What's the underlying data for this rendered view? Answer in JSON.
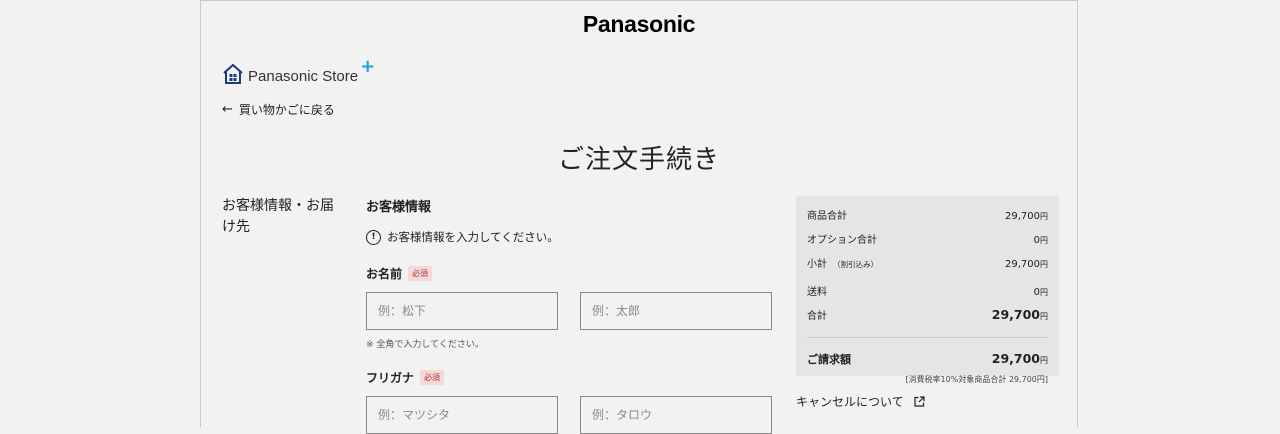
{
  "header": {
    "brand": "Panasonic"
  },
  "store": {
    "name": "Panasonic Store",
    "plus": "+",
    "brand_color": "#1ba1e6"
  },
  "back_link": {
    "arrow": "←",
    "label": "買い物かごに戻る"
  },
  "page_title": "ご注文手続き",
  "section_label": "お客様情報・お届け先",
  "customer_info": {
    "heading": "お客様情報",
    "notice_icon": "!",
    "notice": "お客様情報を入力してください。",
    "name": {
      "label": "お名前",
      "required": "必須",
      "last_placeholder": "例：松下",
      "first_placeholder": "例：太郎",
      "hint": "※ 全角で入力してください。"
    },
    "kana": {
      "label": "フリガナ",
      "required": "必須",
      "last_placeholder": "例：マツシタ",
      "first_placeholder": "例：タロウ"
    }
  },
  "summary": {
    "product_total_label": "商品合計",
    "product_total_value": "29,700",
    "option_total_label": "オプション合計",
    "option_total_value": "0",
    "subtotal_label": "小計",
    "subtotal_note": "（割引込み）",
    "subtotal_value": "29,700",
    "shipping_label": "送料",
    "shipping_value": "0",
    "total_label": "合計",
    "total_value": "29,700",
    "billing_label": "ご請求額",
    "billing_value": "29,700",
    "currency": "円",
    "tax_note": "[消費税率10%対象商品合計 29,700円]"
  },
  "cancel_link": {
    "label": "キャンセルについて",
    "icon": "external-link-icon"
  }
}
